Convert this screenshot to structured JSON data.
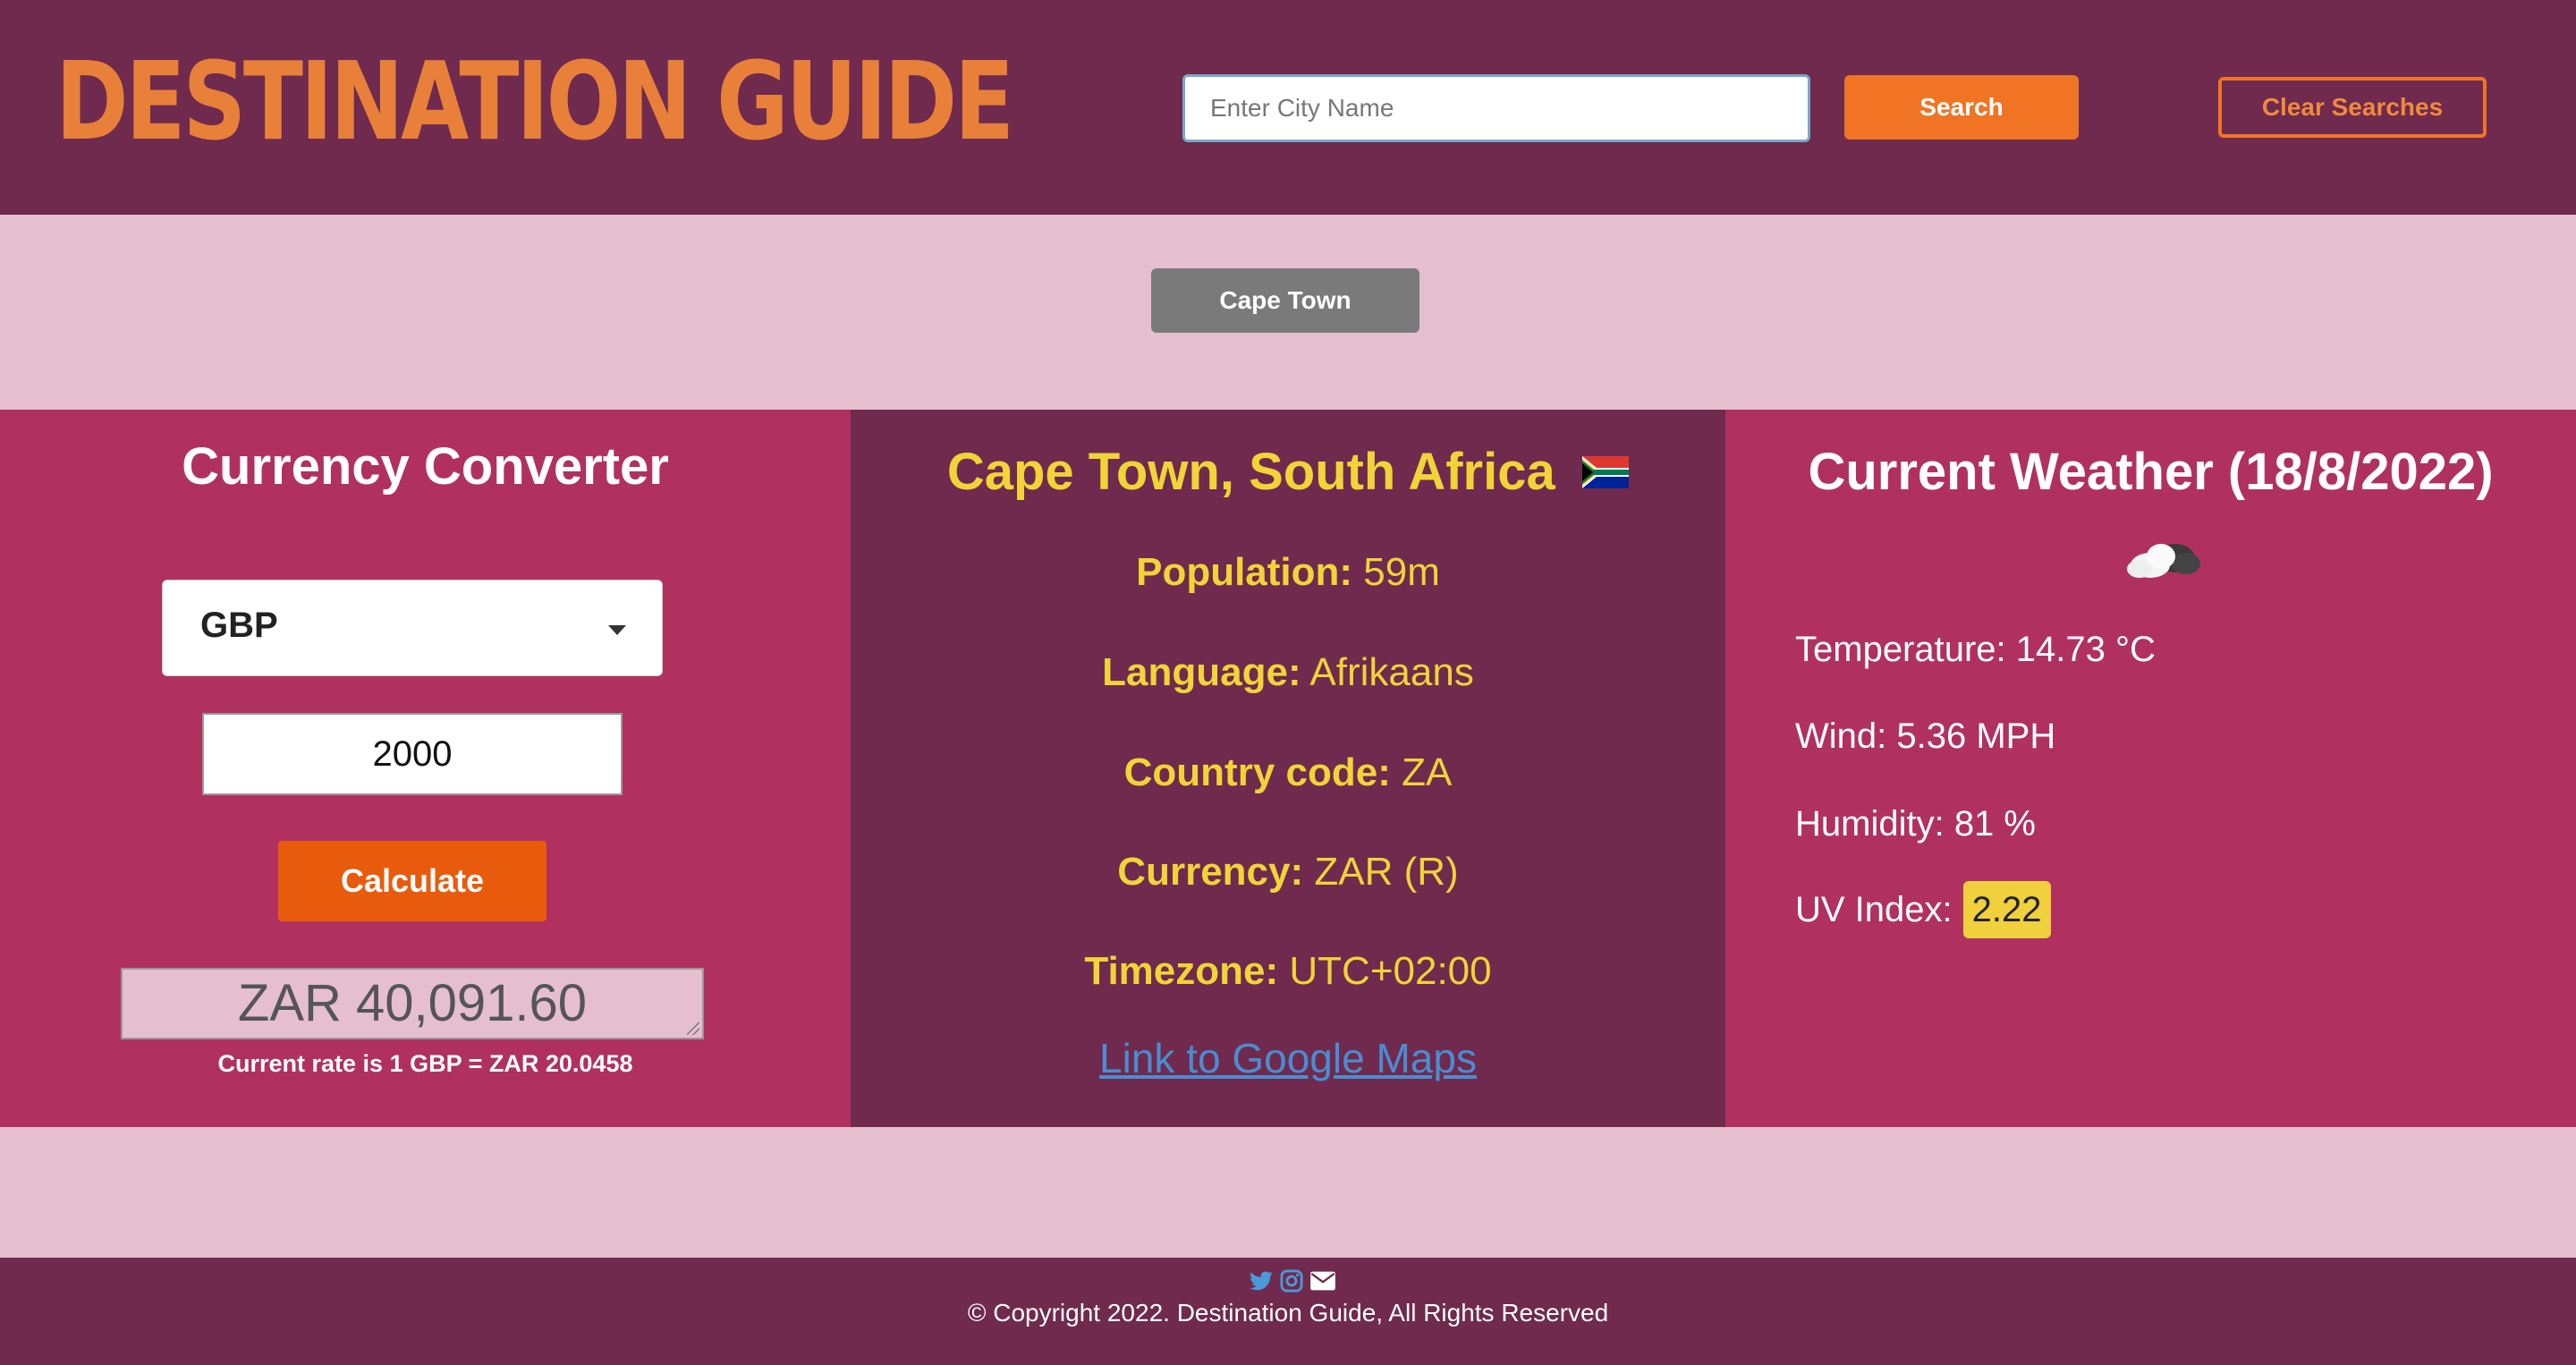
{
  "header": {
    "logo": "DESTINATION GUIDE",
    "search_placeholder": "Enter City Name",
    "search_label": "Search",
    "clear_label": "Clear Searches"
  },
  "history": {
    "items": [
      {
        "label": "Cape Town"
      }
    ]
  },
  "currency": {
    "title": "Currency Converter",
    "selected": "GBP",
    "amount": "2000",
    "calculate_label": "Calculate",
    "result": "ZAR 40,091.60",
    "rate_text": "Current rate is 1 GBP = ZAR 20.0458"
  },
  "city": {
    "title": "Cape Town, South Africa",
    "flag_icon": "south-africa-flag-icon",
    "population_label": "Population:",
    "population_value": "59m",
    "language_label": "Language:",
    "language_value": "Afrikaans",
    "code_label": "Country code:",
    "code_value": "ZA",
    "currency_label": "Currency:",
    "currency_value": "ZAR (R)",
    "timezone_label": "Timezone:",
    "timezone_value": "UTC+02:00",
    "maps_link": "Link to Google Maps"
  },
  "weather": {
    "title": "Current Weather (18/8/2022)",
    "icon": "cloudy-night-icon",
    "temperature": "Temperature: 14.73 °C",
    "wind": "Wind: 5.36 MPH",
    "humidity": "Humidity: 81 %",
    "uv_label": "UV Index:",
    "uv_value": "2.22",
    "uv_color": "#f0d03c"
  },
  "footer": {
    "icons": [
      "twitter-icon",
      "instagram-icon",
      "envelope-icon"
    ],
    "copyright": "© Copyright 2022. Destination Guide, All Rights Reserved"
  },
  "colors": {
    "header_bg": "#6f2a4e",
    "panel_bg": "#b03160",
    "page_bg": "#e5bfce",
    "accent": "#f07424",
    "city_text": "#f0d438"
  }
}
